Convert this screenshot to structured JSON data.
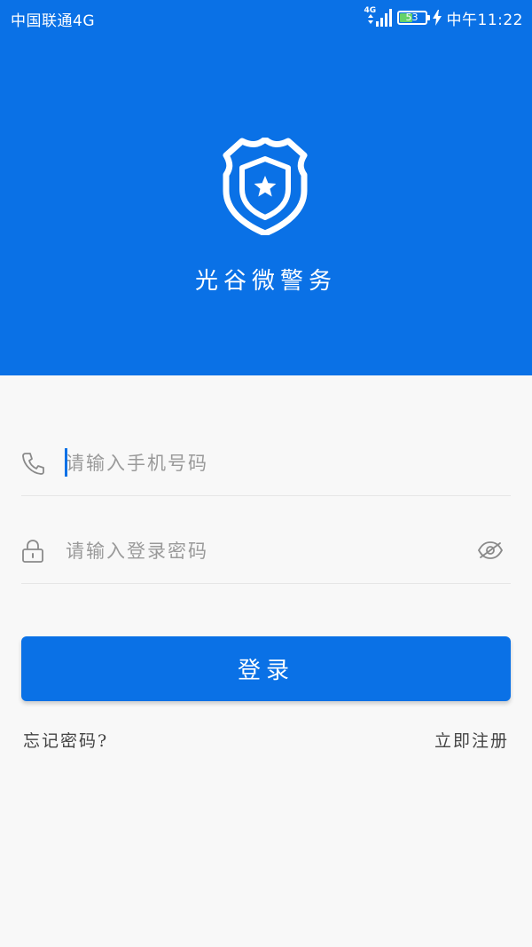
{
  "status_bar": {
    "carrier": "中国联通4G",
    "network_tag": "4G",
    "battery_level": "53",
    "time": "中午11:22"
  },
  "app": {
    "name": "光谷微警务",
    "logo_icon": "police-badge-icon"
  },
  "form": {
    "phone": {
      "icon": "phone-icon",
      "placeholder": "请输入手机号码",
      "value": ""
    },
    "password": {
      "icon": "lock-icon",
      "placeholder": "请输入登录密码",
      "value": "",
      "toggle_icon": "eye-hidden-icon"
    },
    "login_label": "登录"
  },
  "links": {
    "forgot": "忘记密码?",
    "register": "立即注册"
  },
  "colors": {
    "primary": "#0a71e6",
    "background": "#f8f8f8",
    "battery": "#66d26a"
  }
}
